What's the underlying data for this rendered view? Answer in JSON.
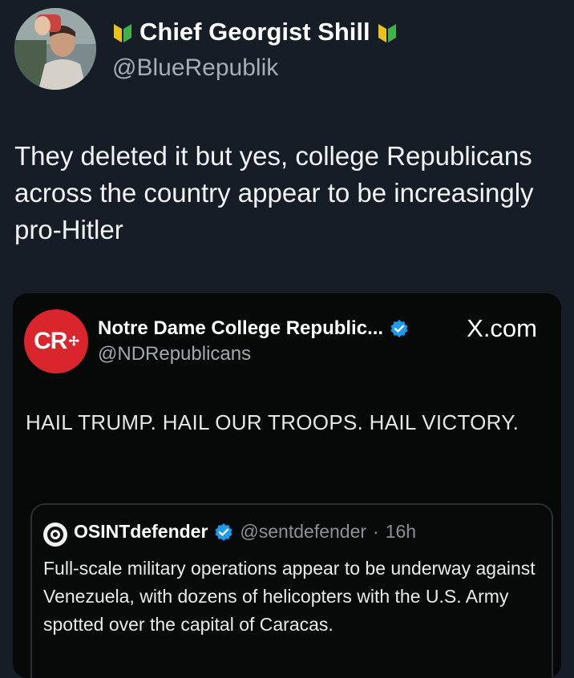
{
  "author": {
    "display_name": "Chief Georgist Shill",
    "handle": "@BlueRepublik",
    "avatar_icon": "profile-photo",
    "badge_icon": "green-yellow-leaf-icon"
  },
  "tweet": {
    "text": "They deleted it but yes, college Republicans across the country appear to be increasingly pro-Hitler"
  },
  "embed": {
    "logo_text": "CR",
    "display_name": "Notre Dame College Republic...",
    "handle": "@NDRepublicans",
    "source": "X.com",
    "text": "HAIL TRUMP. HAIL OUR TROOPS. HAIL VICTORY.",
    "verified_color": "#1d9bf0",
    "logo_color": "#d9252b"
  },
  "quote": {
    "display_name": "OSINTdefender",
    "handle": "@sentdefender",
    "separator": "·",
    "time": "16h",
    "text": "Full-scale military operations appear to be underway against Venezuela, with dozens of helicopters with the U.S. Army spotted over the capital of Caracas."
  }
}
